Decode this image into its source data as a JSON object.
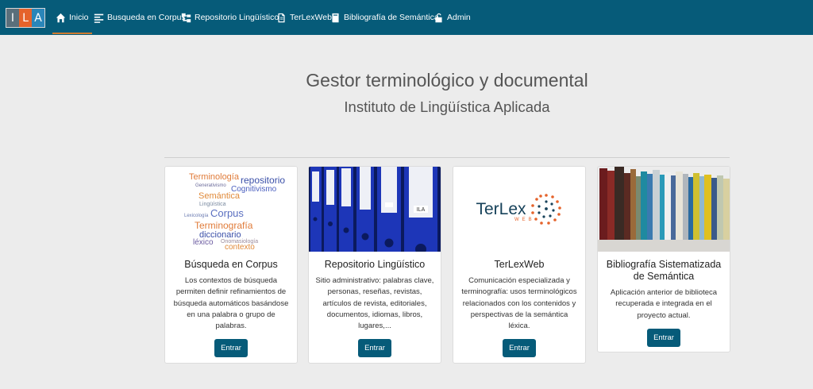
{
  "logo": {
    "letters": [
      "I",
      "L",
      "A"
    ]
  },
  "nav": {
    "items": [
      {
        "label": "Inicio",
        "icon": "home-icon"
      },
      {
        "label": "Busqueda en Corpus",
        "icon": "align-left-icon"
      },
      {
        "label": "Repositorio Lingüístico",
        "icon": "sitemap-icon"
      },
      {
        "label": "TerLexWeb",
        "icon": "document-icon"
      },
      {
        "label": "Bibliografía de Semántica",
        "icon": "book-icon"
      },
      {
        "label": "Admin",
        "icon": "unlock-icon"
      }
    ]
  },
  "header": {
    "title": "Gestor terminológico y documental",
    "subtitle": "Instituto de Lingüística Aplicada"
  },
  "cards": [
    {
      "title": "Búsqueda en Corpus",
      "description": "Los contextos de búsqueda permiten definir refinamientos de búsqueda automáticos basándose en una palabra o grupo de palabras.",
      "button": "Entrar",
      "image": "word-cloud-image"
    },
    {
      "title": "Repositorio Lingüístico",
      "description": "Sitio administrativo: palabras clave, personas, reseñas, revistas, artículos de revista, editoriales, documentos, idiomas, libros, lugares,...",
      "button": "Entrar",
      "image": "blue-binders-image"
    },
    {
      "title": "TerLexWeb",
      "description": "Comunicación especializada y terminografía: usos terminológicos relacionados con los contenidos y perspectivas de la semántica léxica.",
      "button": "Entrar",
      "image": "terlexweb-logo-image"
    },
    {
      "title": "Bibliografía Sistematizada de Semántica",
      "description": "Aplicación anterior de biblioteca recuperada e integrada en el proyecto actual.",
      "button": "Entrar",
      "image": "bookshelf-image"
    }
  ],
  "word_cloud": [
    {
      "text": "Terminología",
      "color": "#e07b39"
    },
    {
      "text": "repositorio",
      "color": "#3a4fa8"
    },
    {
      "text": "Generativismo",
      "color": "#6a6a9a"
    },
    {
      "text": "Cognitivismo",
      "color": "#4a5fbf"
    },
    {
      "text": "Semántica",
      "color": "#e08a3a"
    },
    {
      "text": "Lingüística",
      "color": "#7a8aa0"
    },
    {
      "text": "Corpus",
      "color": "#5a6fc0"
    },
    {
      "text": "Lexicología",
      "color": "#6a7ab0"
    },
    {
      "text": "Terminografía",
      "color": "#e07b39"
    },
    {
      "text": "diccionario",
      "color": "#3a4fa8"
    },
    {
      "text": "léxico",
      "color": "#6a5aa0"
    },
    {
      "text": "Onomasiología",
      "color": "#9a8a9a"
    },
    {
      "text": "contexto",
      "color": "#e08a3a"
    }
  ],
  "terlex_logo": {
    "name": "TerLex",
    "tag": "WEB"
  },
  "binder_label": "ILA"
}
